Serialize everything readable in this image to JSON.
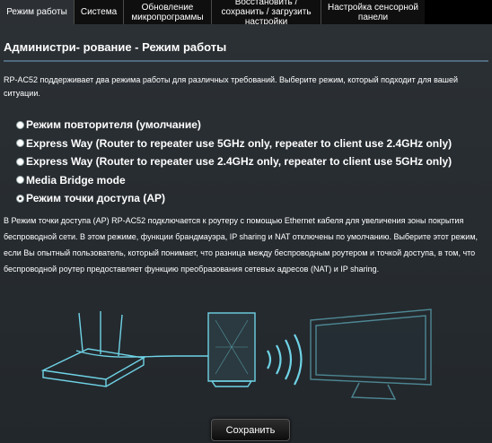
{
  "tabs": [
    {
      "label": "Режим работы"
    },
    {
      "label": "Система"
    },
    {
      "label": "Обновление микропрограммы"
    },
    {
      "label": "Восстановить / сохранить / загрузить настройки"
    },
    {
      "label": "Настройка сенсорной панели"
    }
  ],
  "page": {
    "title": "Администри- рование - Режим работы",
    "description": "RP-AC52 поддерживает два режима работы для различных требований. Выберите режим, который подходит для вашей ситуации."
  },
  "modes": [
    {
      "label": "Режим повторителя (умолчание)",
      "checked": false
    },
    {
      "label": "Express Way (Router to repeater use 5GHz only, repeater to client use 2.4GHz only)",
      "checked": false
    },
    {
      "label": "Express Way (Router to repeater use 2.4GHz only, repeater to client use 5GHz only)",
      "checked": false
    },
    {
      "label": "Media Bridge mode",
      "checked": false
    },
    {
      "label": "Режим точки доступа (AP)",
      "checked": true
    }
  ],
  "explanation": "В Режим точки доступа (AP) RP-AC52 подключается к роутеру с помощью Ethernet кабеля для увеличения зоны покрытия беспроводной сети. В этом режиме, функции брандмауэра, IP sharing и NAT отключены по умолчанию. Выберите этот режим, если Вы опытный пользователь, который понимает, что разница между беспроводным роутером и точкой доступа, в том, что беспроводной роутер предоставляет функцию преобразования сетевых адресов (NAT) и IP sharing.",
  "save_label": "Сохранить",
  "colors": {
    "accent": "#4f6b7d",
    "panel": "#2b3035",
    "illustration": "#6fd3e6"
  }
}
